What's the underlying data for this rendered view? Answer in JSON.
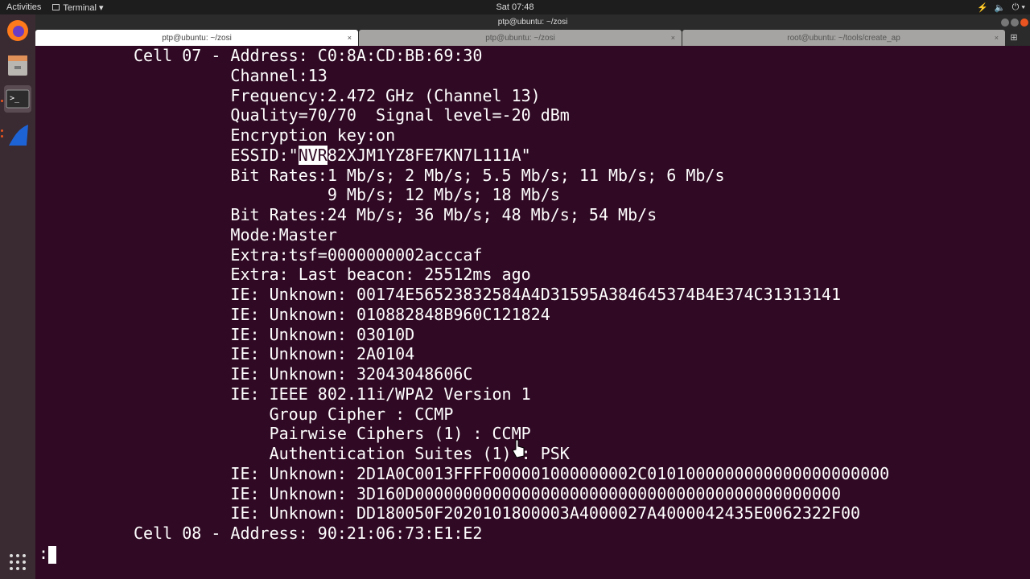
{
  "topbar": {
    "activities": "Activities",
    "app": "Terminal ▾",
    "clock": "Sat 07:48",
    "sys": [
      "⚡",
      "🔈",
      "⏻ ▾"
    ]
  },
  "window": {
    "title": "ptp@ubuntu: ~/zosi"
  },
  "tabs": [
    {
      "label": "ptp@ubuntu: ~/zosi",
      "close": "×"
    },
    {
      "label": "ptp@ubuntu: ~/zosi",
      "close": "×"
    },
    {
      "label": "root@ubuntu: ~/tools/create_ap",
      "close": "×"
    }
  ],
  "dock": [
    "firefox-icon",
    "files-icon",
    "terminal-icon",
    "wireshark-icon",
    "show-apps-icon"
  ],
  "terminal": {
    "lines": [
      "Cell 07 - Address: C0:8A:CD:BB:69:30",
      "          Channel:13",
      "          Frequency:2.472 GHz (Channel 13)",
      "          Quality=70/70  Signal level=-20 dBm",
      "          Encryption key:on",
      "__ESSID__",
      "          Bit Rates:1 Mb/s; 2 Mb/s; 5.5 Mb/s; 11 Mb/s; 6 Mb/s",
      "                    9 Mb/s; 12 Mb/s; 18 Mb/s",
      "          Bit Rates:24 Mb/s; 36 Mb/s; 48 Mb/s; 54 Mb/s",
      "          Mode:Master",
      "          Extra:tsf=0000000002acccaf",
      "          Extra: Last beacon: 25512ms ago",
      "          IE: Unknown: 00174E56523832584A4D31595A384645374B4E374C31313141",
      "          IE: Unknown: 010882848B960C121824",
      "          IE: Unknown: 03010D",
      "          IE: Unknown: 2A0104",
      "          IE: Unknown: 32043048606C",
      "          IE: IEEE 802.11i/WPA2 Version 1",
      "              Group Cipher : CCMP",
      "              Pairwise Ciphers (1) : CCMP",
      "              Authentication Suites (1) : PSK",
      "          IE: Unknown: 2D1A0C0013FFFF000001000000002C0101000000000000000000000",
      "          IE: Unknown: 3D160D00000000000000000000000000000000000000000000",
      "          IE: Unknown: DD180050F2020101800003A4000027A4000042435E0062322F00",
      "Cell 08 - Address: 90:21:06:73:E1:E2"
    ],
    "essid_prefix": "          ESSID:\"",
    "essid_highlight": "NVR",
    "essid_rest": "82XJM1YZ8FE7KN7L111A\"",
    "prompt": ":"
  }
}
